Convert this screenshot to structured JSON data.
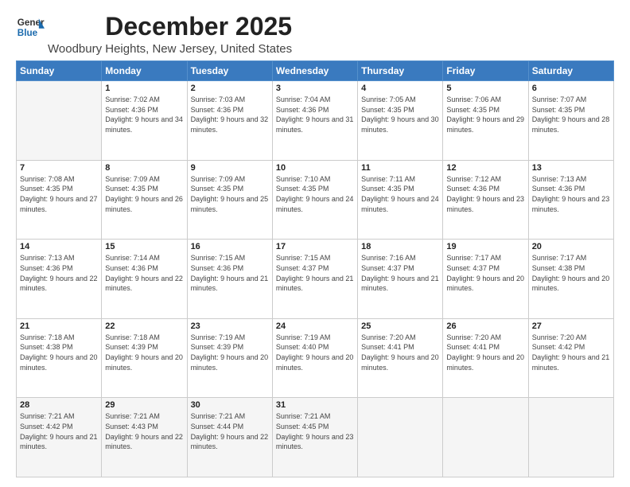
{
  "logo": {
    "general": "General",
    "blue": "Blue"
  },
  "title": "December 2025",
  "subtitle": "Woodbury Heights, New Jersey, United States",
  "days_of_week": [
    "Sunday",
    "Monday",
    "Tuesday",
    "Wednesday",
    "Thursday",
    "Friday",
    "Saturday"
  ],
  "weeks": [
    [
      {
        "day": "",
        "sunrise": "",
        "sunset": "",
        "daylight": ""
      },
      {
        "day": "1",
        "sunrise": "Sunrise: 7:02 AM",
        "sunset": "Sunset: 4:36 PM",
        "daylight": "Daylight: 9 hours and 34 minutes."
      },
      {
        "day": "2",
        "sunrise": "Sunrise: 7:03 AM",
        "sunset": "Sunset: 4:36 PM",
        "daylight": "Daylight: 9 hours and 32 minutes."
      },
      {
        "day": "3",
        "sunrise": "Sunrise: 7:04 AM",
        "sunset": "Sunset: 4:36 PM",
        "daylight": "Daylight: 9 hours and 31 minutes."
      },
      {
        "day": "4",
        "sunrise": "Sunrise: 7:05 AM",
        "sunset": "Sunset: 4:35 PM",
        "daylight": "Daylight: 9 hours and 30 minutes."
      },
      {
        "day": "5",
        "sunrise": "Sunrise: 7:06 AM",
        "sunset": "Sunset: 4:35 PM",
        "daylight": "Daylight: 9 hours and 29 minutes."
      },
      {
        "day": "6",
        "sunrise": "Sunrise: 7:07 AM",
        "sunset": "Sunset: 4:35 PM",
        "daylight": "Daylight: 9 hours and 28 minutes."
      }
    ],
    [
      {
        "day": "7",
        "sunrise": "Sunrise: 7:08 AM",
        "sunset": "Sunset: 4:35 PM",
        "daylight": "Daylight: 9 hours and 27 minutes."
      },
      {
        "day": "8",
        "sunrise": "Sunrise: 7:09 AM",
        "sunset": "Sunset: 4:35 PM",
        "daylight": "Daylight: 9 hours and 26 minutes."
      },
      {
        "day": "9",
        "sunrise": "Sunrise: 7:09 AM",
        "sunset": "Sunset: 4:35 PM",
        "daylight": "Daylight: 9 hours and 25 minutes."
      },
      {
        "day": "10",
        "sunrise": "Sunrise: 7:10 AM",
        "sunset": "Sunset: 4:35 PM",
        "daylight": "Daylight: 9 hours and 24 minutes."
      },
      {
        "day": "11",
        "sunrise": "Sunrise: 7:11 AM",
        "sunset": "Sunset: 4:35 PM",
        "daylight": "Daylight: 9 hours and 24 minutes."
      },
      {
        "day": "12",
        "sunrise": "Sunrise: 7:12 AM",
        "sunset": "Sunset: 4:36 PM",
        "daylight": "Daylight: 9 hours and 23 minutes."
      },
      {
        "day": "13",
        "sunrise": "Sunrise: 7:13 AM",
        "sunset": "Sunset: 4:36 PM",
        "daylight": "Daylight: 9 hours and 23 minutes."
      }
    ],
    [
      {
        "day": "14",
        "sunrise": "Sunrise: 7:13 AM",
        "sunset": "Sunset: 4:36 PM",
        "daylight": "Daylight: 9 hours and 22 minutes."
      },
      {
        "day": "15",
        "sunrise": "Sunrise: 7:14 AM",
        "sunset": "Sunset: 4:36 PM",
        "daylight": "Daylight: 9 hours and 22 minutes."
      },
      {
        "day": "16",
        "sunrise": "Sunrise: 7:15 AM",
        "sunset": "Sunset: 4:36 PM",
        "daylight": "Daylight: 9 hours and 21 minutes."
      },
      {
        "day": "17",
        "sunrise": "Sunrise: 7:15 AM",
        "sunset": "Sunset: 4:37 PM",
        "daylight": "Daylight: 9 hours and 21 minutes."
      },
      {
        "day": "18",
        "sunrise": "Sunrise: 7:16 AM",
        "sunset": "Sunset: 4:37 PM",
        "daylight": "Daylight: 9 hours and 21 minutes."
      },
      {
        "day": "19",
        "sunrise": "Sunrise: 7:17 AM",
        "sunset": "Sunset: 4:37 PM",
        "daylight": "Daylight: 9 hours and 20 minutes."
      },
      {
        "day": "20",
        "sunrise": "Sunrise: 7:17 AM",
        "sunset": "Sunset: 4:38 PM",
        "daylight": "Daylight: 9 hours and 20 minutes."
      }
    ],
    [
      {
        "day": "21",
        "sunrise": "Sunrise: 7:18 AM",
        "sunset": "Sunset: 4:38 PM",
        "daylight": "Daylight: 9 hours and 20 minutes."
      },
      {
        "day": "22",
        "sunrise": "Sunrise: 7:18 AM",
        "sunset": "Sunset: 4:39 PM",
        "daylight": "Daylight: 9 hours and 20 minutes."
      },
      {
        "day": "23",
        "sunrise": "Sunrise: 7:19 AM",
        "sunset": "Sunset: 4:39 PM",
        "daylight": "Daylight: 9 hours and 20 minutes."
      },
      {
        "day": "24",
        "sunrise": "Sunrise: 7:19 AM",
        "sunset": "Sunset: 4:40 PM",
        "daylight": "Daylight: 9 hours and 20 minutes."
      },
      {
        "day": "25",
        "sunrise": "Sunrise: 7:20 AM",
        "sunset": "Sunset: 4:41 PM",
        "daylight": "Daylight: 9 hours and 20 minutes."
      },
      {
        "day": "26",
        "sunrise": "Sunrise: 7:20 AM",
        "sunset": "Sunset: 4:41 PM",
        "daylight": "Daylight: 9 hours and 20 minutes."
      },
      {
        "day": "27",
        "sunrise": "Sunrise: 7:20 AM",
        "sunset": "Sunset: 4:42 PM",
        "daylight": "Daylight: 9 hours and 21 minutes."
      }
    ],
    [
      {
        "day": "28",
        "sunrise": "Sunrise: 7:21 AM",
        "sunset": "Sunset: 4:42 PM",
        "daylight": "Daylight: 9 hours and 21 minutes."
      },
      {
        "day": "29",
        "sunrise": "Sunrise: 7:21 AM",
        "sunset": "Sunset: 4:43 PM",
        "daylight": "Daylight: 9 hours and 22 minutes."
      },
      {
        "day": "30",
        "sunrise": "Sunrise: 7:21 AM",
        "sunset": "Sunset: 4:44 PM",
        "daylight": "Daylight: 9 hours and 22 minutes."
      },
      {
        "day": "31",
        "sunrise": "Sunrise: 7:21 AM",
        "sunset": "Sunset: 4:45 PM",
        "daylight": "Daylight: 9 hours and 23 minutes."
      },
      {
        "day": "",
        "sunrise": "",
        "sunset": "",
        "daylight": ""
      },
      {
        "day": "",
        "sunrise": "",
        "sunset": "",
        "daylight": ""
      },
      {
        "day": "",
        "sunrise": "",
        "sunset": "",
        "daylight": ""
      }
    ]
  ]
}
